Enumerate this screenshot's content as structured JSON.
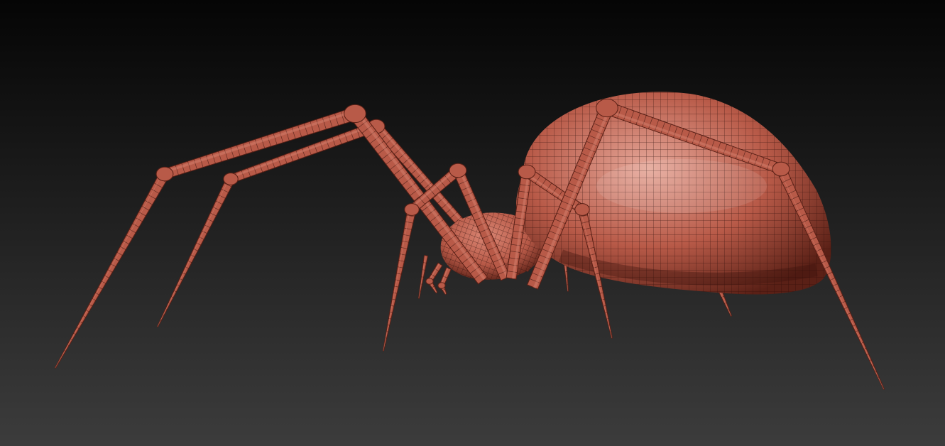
{
  "scene": {
    "subject": "spider",
    "background_top": "#050505",
    "background_bottom": "#3c3c3c",
    "colors": {
      "body_base": "#b85a48",
      "body_light": "#d98573",
      "body_dark": "#5a2016",
      "wire": "#2a0c08",
      "highlight": "#e6a89a"
    }
  }
}
